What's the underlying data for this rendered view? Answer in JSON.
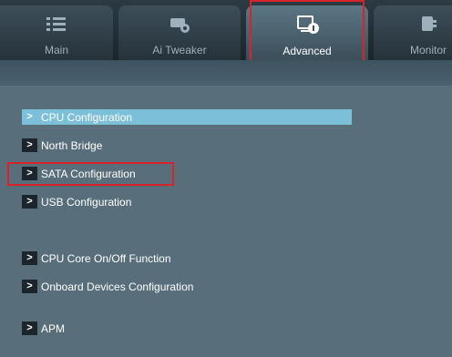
{
  "tabs": [
    {
      "label": "Main",
      "icon": "list-icon"
    },
    {
      "label": "Ai  Tweaker",
      "icon": "tweaker-icon"
    },
    {
      "label": "Advanced",
      "icon": "advanced-icon"
    },
    {
      "label": "Monitor",
      "icon": "monitor-icon"
    }
  ],
  "menu": [
    {
      "label": "CPU Configuration",
      "arrow": ">"
    },
    {
      "label": "North Bridge",
      "arrow": ">"
    },
    {
      "label": "SATA Configuration",
      "arrow": ">"
    },
    {
      "label": "USB Configuration",
      "arrow": ">"
    },
    {
      "label": "CPU Core On/Off Function",
      "arrow": ">"
    },
    {
      "label": "Onboard Devices Configuration",
      "arrow": ">"
    },
    {
      "label": "APM",
      "arrow": ">"
    }
  ],
  "colors": {
    "highlight": "#d8232a",
    "selected_bg": "#7bbfd9"
  }
}
